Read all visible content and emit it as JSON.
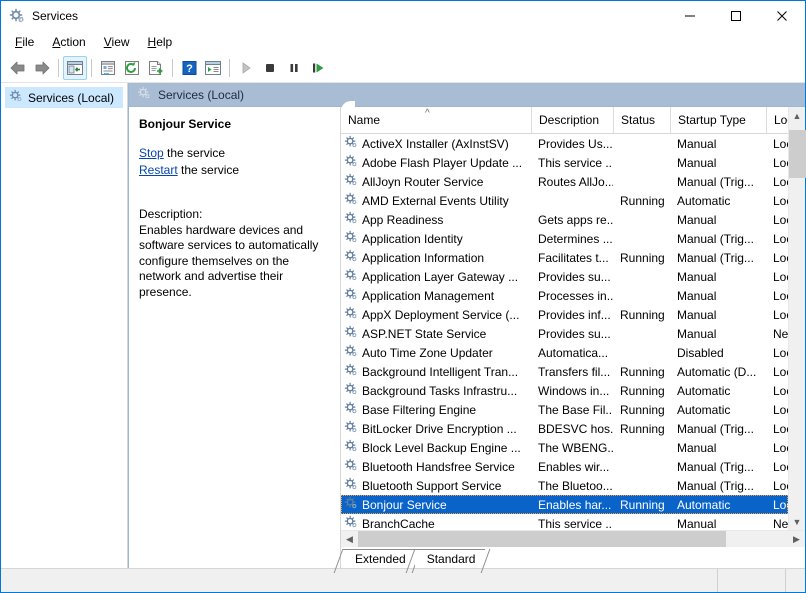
{
  "window": {
    "title": "Services",
    "icon": "services-gear-icon",
    "controls": {
      "minimize": "Minimize",
      "maximize": "Maximize",
      "close": "Close"
    }
  },
  "menubar": {
    "items": [
      {
        "label": "File",
        "accel": "F"
      },
      {
        "label": "Action",
        "accel": "A"
      },
      {
        "label": "View",
        "accel": "V"
      },
      {
        "label": "Help",
        "accel": "H"
      }
    ]
  },
  "toolbar": {
    "buttons": [
      {
        "name": "back-icon",
        "tooltip": "Back"
      },
      {
        "name": "forward-icon",
        "tooltip": "Forward"
      },
      {
        "name": "show-hide-tree-icon",
        "tooltip": "Show/Hide Console Tree",
        "pressed": true
      },
      {
        "name": "properties-icon",
        "tooltip": "Properties"
      },
      {
        "name": "refresh-icon",
        "tooltip": "Refresh"
      },
      {
        "name": "export-list-icon",
        "tooltip": "Export List"
      },
      {
        "name": "help-icon",
        "tooltip": "Help"
      },
      {
        "name": "show-action-pane-icon",
        "tooltip": "Show/Hide Action Pane"
      },
      {
        "name": "start-service-icon",
        "tooltip": "Start Service"
      },
      {
        "name": "stop-service-icon",
        "tooltip": "Stop Service"
      },
      {
        "name": "pause-service-icon",
        "tooltip": "Pause Service"
      },
      {
        "name": "restart-service-icon",
        "tooltip": "Restart Service"
      }
    ]
  },
  "tree": {
    "root_label": "Services (Local)",
    "root_icon": "services-gear-icon"
  },
  "pane": {
    "header_label": "Services (Local)",
    "header_icon": "services-gear-icon",
    "header_bg": "#a8bcd4"
  },
  "detail": {
    "service_title": "Bonjour Service",
    "actions": [
      {
        "link": "Stop",
        "suffix": " the service"
      },
      {
        "link": "Restart",
        "suffix": " the service"
      }
    ],
    "description_label": "Description:",
    "description_text": "Enables hardware devices and software services to automatically configure themselves on the network and advertise their presence."
  },
  "list": {
    "columns": [
      {
        "key": "name",
        "label": "Name",
        "sorted": true,
        "sort_dir": "asc"
      },
      {
        "key": "desc",
        "label": "Description"
      },
      {
        "key": "status",
        "label": "Status"
      },
      {
        "key": "startup",
        "label": "Startup Type"
      },
      {
        "key": "logon",
        "label": "Log"
      }
    ],
    "selection_color": "#0a63c9",
    "rows": [
      {
        "name": "ActiveX Installer (AxInstSV)",
        "desc": "Provides Us...",
        "status": "",
        "startup": "Manual",
        "logon": "Loc",
        "selected": false
      },
      {
        "name": "Adobe Flash Player Update ...",
        "desc": "This service ...",
        "status": "",
        "startup": "Manual",
        "logon": "Loc",
        "selected": false
      },
      {
        "name": "AllJoyn Router Service",
        "desc": "Routes AllJo...",
        "status": "",
        "startup": "Manual (Trig...",
        "logon": "Loc",
        "selected": false
      },
      {
        "name": "AMD External Events Utility",
        "desc": "",
        "status": "Running",
        "startup": "Automatic",
        "logon": "Loc",
        "selected": false
      },
      {
        "name": "App Readiness",
        "desc": "Gets apps re...",
        "status": "",
        "startup": "Manual",
        "logon": "Loc",
        "selected": false
      },
      {
        "name": "Application Identity",
        "desc": "Determines ...",
        "status": "",
        "startup": "Manual (Trig...",
        "logon": "Loc",
        "selected": false
      },
      {
        "name": "Application Information",
        "desc": "Facilitates t...",
        "status": "Running",
        "startup": "Manual (Trig...",
        "logon": "Loc",
        "selected": false
      },
      {
        "name": "Application Layer Gateway ...",
        "desc": "Provides su...",
        "status": "",
        "startup": "Manual",
        "logon": "Loc",
        "selected": false
      },
      {
        "name": "Application Management",
        "desc": "Processes in...",
        "status": "",
        "startup": "Manual",
        "logon": "Loc",
        "selected": false
      },
      {
        "name": "AppX Deployment Service (...",
        "desc": "Provides inf...",
        "status": "Running",
        "startup": "Manual",
        "logon": "Loc",
        "selected": false
      },
      {
        "name": "ASP.NET State Service",
        "desc": "Provides su...",
        "status": "",
        "startup": "Manual",
        "logon": "Net",
        "selected": false
      },
      {
        "name": "Auto Time Zone Updater",
        "desc": "Automatica...",
        "status": "",
        "startup": "Disabled",
        "logon": "Loc",
        "selected": false
      },
      {
        "name": "Background Intelligent Tran...",
        "desc": "Transfers fil...",
        "status": "Running",
        "startup": "Automatic (D...",
        "logon": "Loc",
        "selected": false
      },
      {
        "name": "Background Tasks Infrastru...",
        "desc": "Windows in...",
        "status": "Running",
        "startup": "Automatic",
        "logon": "Loc",
        "selected": false
      },
      {
        "name": "Base Filtering Engine",
        "desc": "The Base Fil...",
        "status": "Running",
        "startup": "Automatic",
        "logon": "Loc",
        "selected": false
      },
      {
        "name": "BitLocker Drive Encryption ...",
        "desc": "BDESVC hos...",
        "status": "Running",
        "startup": "Manual (Trig...",
        "logon": "Loc",
        "selected": false
      },
      {
        "name": "Block Level Backup Engine ...",
        "desc": "The WBENG...",
        "status": "",
        "startup": "Manual",
        "logon": "Loc",
        "selected": false
      },
      {
        "name": "Bluetooth Handsfree Service",
        "desc": "Enables wir...",
        "status": "",
        "startup": "Manual (Trig...",
        "logon": "Loc",
        "selected": false
      },
      {
        "name": "Bluetooth Support Service",
        "desc": "The Bluetoo...",
        "status": "",
        "startup": "Manual (Trig...",
        "logon": "Loc",
        "selected": false
      },
      {
        "name": "Bonjour Service",
        "desc": "Enables har...",
        "status": "Running",
        "startup": "Automatic",
        "logon": "Loc",
        "selected": true
      },
      {
        "name": "BranchCache",
        "desc": "This service ...",
        "status": "",
        "startup": "Manual",
        "logon": "Net",
        "selected": false
      }
    ],
    "vscroll": {
      "up_icon": "chevron-up-icon",
      "down_icon": "chevron-down-icon"
    },
    "hscroll": {
      "left_icon": "chevron-left-icon",
      "right_icon": "chevron-right-icon"
    }
  },
  "tabs": [
    {
      "label": "Extended",
      "active": true
    },
    {
      "label": "Standard",
      "active": false
    }
  ],
  "statusbar": {
    "main": "",
    "mid": "",
    "end": ""
  }
}
